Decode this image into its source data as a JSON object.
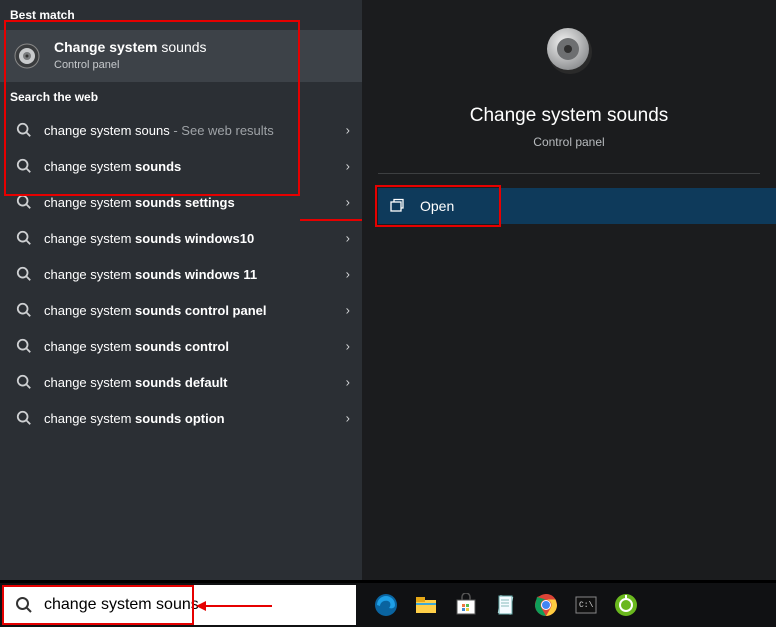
{
  "headers": {
    "bestMatch": "Best match",
    "searchWeb": "Search the web"
  },
  "bestMatch": {
    "title_prefix_bold": "Change system",
    "title_rest": " sounds",
    "subtitle": "Control panel"
  },
  "webResults": [
    {
      "prefix": "change system souns",
      "bold": "",
      "suffix_grey": " - See web results"
    },
    {
      "prefix": "change system ",
      "bold": "sounds",
      "suffix_grey": ""
    },
    {
      "prefix": "change system ",
      "bold": "sounds settings",
      "suffix_grey": ""
    },
    {
      "prefix": "change system ",
      "bold": "sounds windows10",
      "suffix_grey": ""
    },
    {
      "prefix": "change system ",
      "bold": "sounds windows 11",
      "suffix_grey": ""
    },
    {
      "prefix": "change system ",
      "bold": "sounds control panel",
      "suffix_grey": ""
    },
    {
      "prefix": "change system ",
      "bold": "sounds control",
      "suffix_grey": ""
    },
    {
      "prefix": "change system ",
      "bold": "sounds default",
      "suffix_grey": ""
    },
    {
      "prefix": "change system ",
      "bold": "sounds option",
      "suffix_grey": ""
    }
  ],
  "detail": {
    "title": "Change system sounds",
    "subtitle": "Control panel",
    "open": "Open"
  },
  "search": {
    "value": "change system souns"
  }
}
